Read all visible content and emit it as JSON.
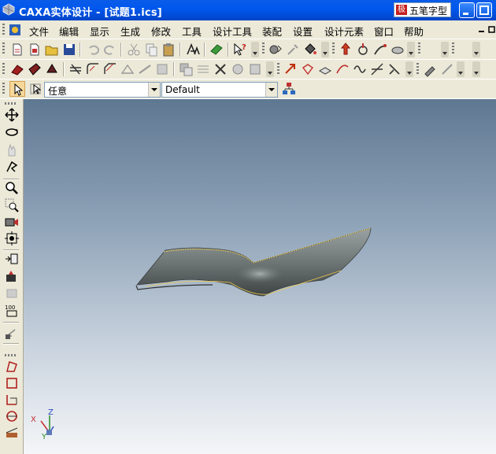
{
  "window": {
    "title": "CAXA实体设计 - [试题1.ics]",
    "ime_label": "五笔字型",
    "ime_badge": "极"
  },
  "menu": {
    "items": [
      "文件",
      "编辑",
      "显示",
      "生成",
      "修改",
      "工具",
      "设计工具",
      "装配",
      "设置",
      "设计元素",
      "窗口",
      "帮助"
    ]
  },
  "selection_bar": {
    "filter_value": "任意",
    "style_value": "Default"
  },
  "viewport": {
    "axes": {
      "x": "X",
      "y": "Y",
      "z": "Z"
    },
    "colors": {
      "part_fill": "#6F7676",
      "part_edge": "#E8C850",
      "bg_top": "#5F7892",
      "bg_bottom": "#F4F6F8"
    }
  },
  "colors": {
    "titlebar": "#0058EE",
    "chrome": "#ECE9D8"
  }
}
